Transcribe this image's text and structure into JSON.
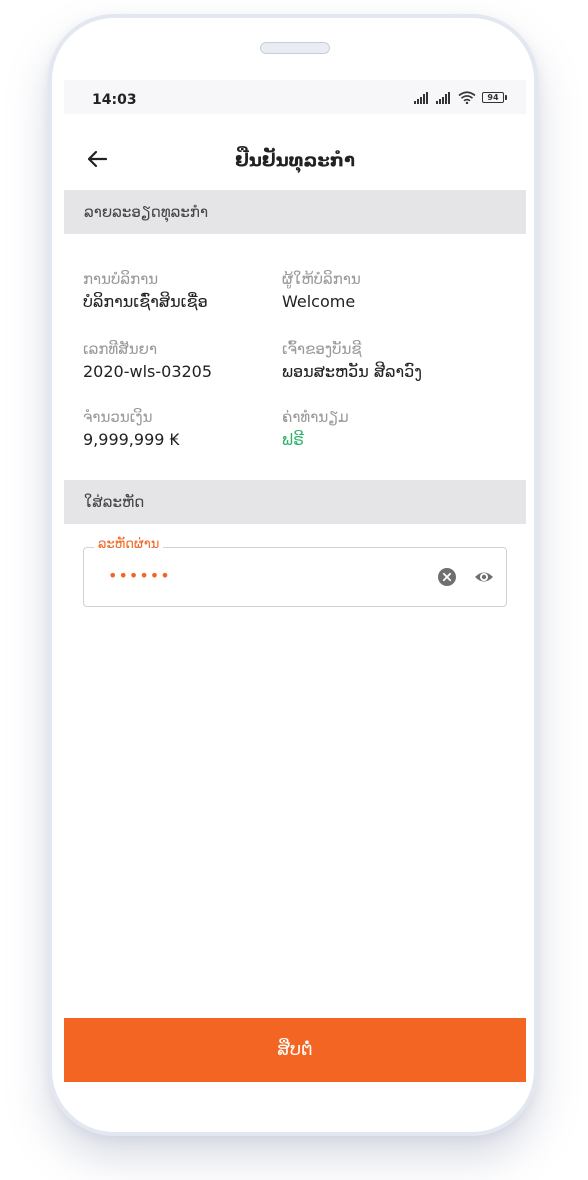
{
  "status_bar": {
    "time": "14:03",
    "battery": "94",
    "icons": [
      "signal-icon",
      "signal-icon",
      "wifi-icon",
      "battery-icon"
    ]
  },
  "header": {
    "title": "ຢືນຢັນທຸລະກຳ",
    "back_icon": "arrow-left-icon"
  },
  "transaction_section": {
    "title": "ລາຍລະອຽດທຸລະກຳ",
    "fields": [
      {
        "label": "ການບໍລິການ",
        "value": "ບໍລິການເຊົ່າສິນເຊື່ອ"
      },
      {
        "label": "ຜູ້ໃຫ້ບໍລິການ",
        "value": "Welcome"
      },
      {
        "label": "ເລກທີສັນຍາ",
        "value": "2020-wls-03205"
      },
      {
        "label": "ເຈົ້າຂອງບັນຊີ",
        "value": "ພອນສະຫວັນ ສີລາວົງ"
      },
      {
        "label": "ຈຳນວນເງິນ",
        "value": "9,999,999 ₭"
      },
      {
        "label": "ຄ່າທຳນຽມ",
        "value": "ຟຣີ"
      }
    ]
  },
  "password_section": {
    "title": "ໃສ່ລະຫັດ",
    "field_label": "ລະຫັດຜ່ານ",
    "field_value": "••••••",
    "clear_icon": "clear-circle-icon",
    "visibility_icon": "eye-icon"
  },
  "footer": {
    "continue_label": "ສືບຕໍ່"
  },
  "colors": {
    "accent": "#f26522",
    "free_green": "#2fb36a",
    "section_bg": "#e5e5e8"
  }
}
